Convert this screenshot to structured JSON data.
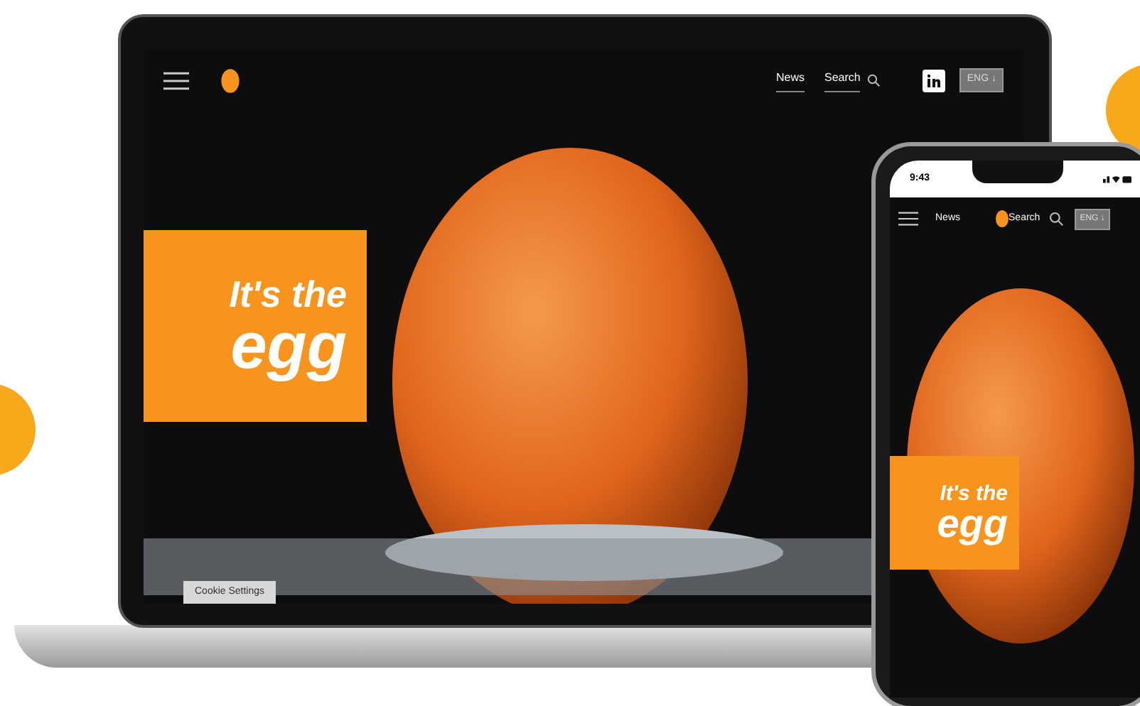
{
  "laptop": {
    "nav": {
      "links": [
        "News",
        "Search"
      ],
      "language": "ENG ↓"
    },
    "hero": {
      "line_1": "It's the",
      "line_2": "egg"
    },
    "cookie_button": "Cookie Settings"
  },
  "phone": {
    "time": "9:43",
    "nav": {
      "links": [
        "News",
        "Search"
      ],
      "language": "ENG ↓"
    },
    "hero": {
      "line_1": "It's the",
      "line_2": "egg"
    }
  }
}
